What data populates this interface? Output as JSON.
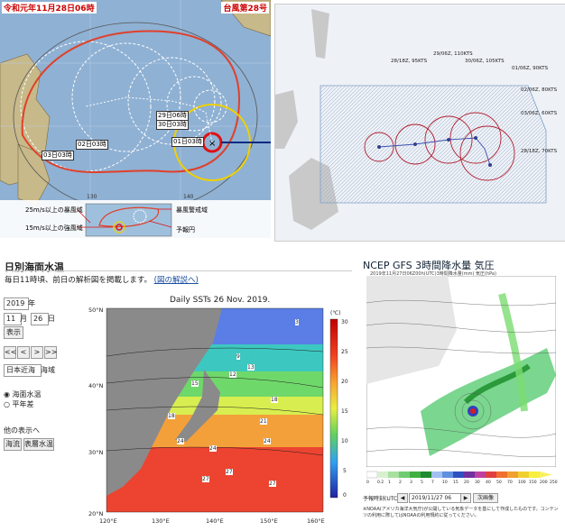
{
  "jma": {
    "header_left": "令和元年11月28日06時",
    "header_right": "台風第28号",
    "label_29": "29日06時",
    "label_30": "30日03時",
    "label_01": "01日03時",
    "label_02": "02日03時",
    "label_03": "03日03時",
    "legend_storm25": "25m/s以上の暴風域",
    "legend_storm15": "15m/s以上の強風域",
    "legend_warning": "暴風警戒域",
    "legend_forecast": "予報円",
    "tick_130": "130",
    "tick_140": "140"
  },
  "jtwc": {
    "labels": [
      "28/18Z, 95KTS",
      "29/06Z, 110KTS",
      "30/06Z, 105KTS",
      "01/06Z, 90KTS",
      "02/06Z, 80KTS",
      "03/06Z, 60KTS",
      "28/18Z, 70KTS"
    ]
  },
  "sst": {
    "page_title": "日別海面水温",
    "desc": "毎日11時頃、前日の解析図を掲載します。",
    "desc_link": "(図の解説へ)",
    "year_value": "2019",
    "year_unit": "年",
    "month_value": "11",
    "month_unit": "月",
    "day_value": "26",
    "day_unit": "日",
    "show_button": "表示",
    "nav_buttons": [
      "<<",
      "<",
      ">",
      ">>"
    ],
    "area_select": "日本近海",
    "area_label": "海域",
    "radio_sst": "海面水温",
    "radio_anom": "平年差",
    "other_label": "他の表示へ",
    "link_a": "海流",
    "link_b": "表層水温",
    "chart_title": "Daily SSTs 26 Nov. 2019.",
    "unit": "(℃)",
    "colorbar_ticks": [
      "30",
      "25",
      "20",
      "15",
      "10",
      "5",
      "0"
    ],
    "lon_ticks": [
      "120°E",
      "130°E",
      "140°E",
      "150°E",
      "160°E"
    ],
    "lat_ticks": [
      "50°N",
      "40°N",
      "30°N",
      "20°N"
    ],
    "contour_labels": [
      "3",
      "9",
      "12",
      "13",
      "15",
      "18",
      "18",
      "21",
      "24",
      "24",
      "24",
      "27",
      "27",
      "27"
    ]
  },
  "ncep": {
    "title": "NCEP GFS 3時間降水量 気圧",
    "subtitle": "2019年11月27日06Z00h(UTC)3時間降水量(mm) 気圧(hPa)",
    "scale_ticks": [
      "0",
      "0.2",
      "1",
      "2",
      "3",
      "5",
      "7",
      "10",
      "15",
      "20",
      "30",
      "40",
      "50",
      "70",
      "100",
      "150",
      "200",
      "250"
    ],
    "controls_label": "予報時刻(UTC)",
    "controls_value": "2019/11/27 06",
    "button_next": "次画像",
    "note": "※NOAA(アメリカ海洋大気庁)が公開している気象データを基にして作成したものです。コンテンツの利用に際してはNOAAの利用規約に従ってください。"
  }
}
